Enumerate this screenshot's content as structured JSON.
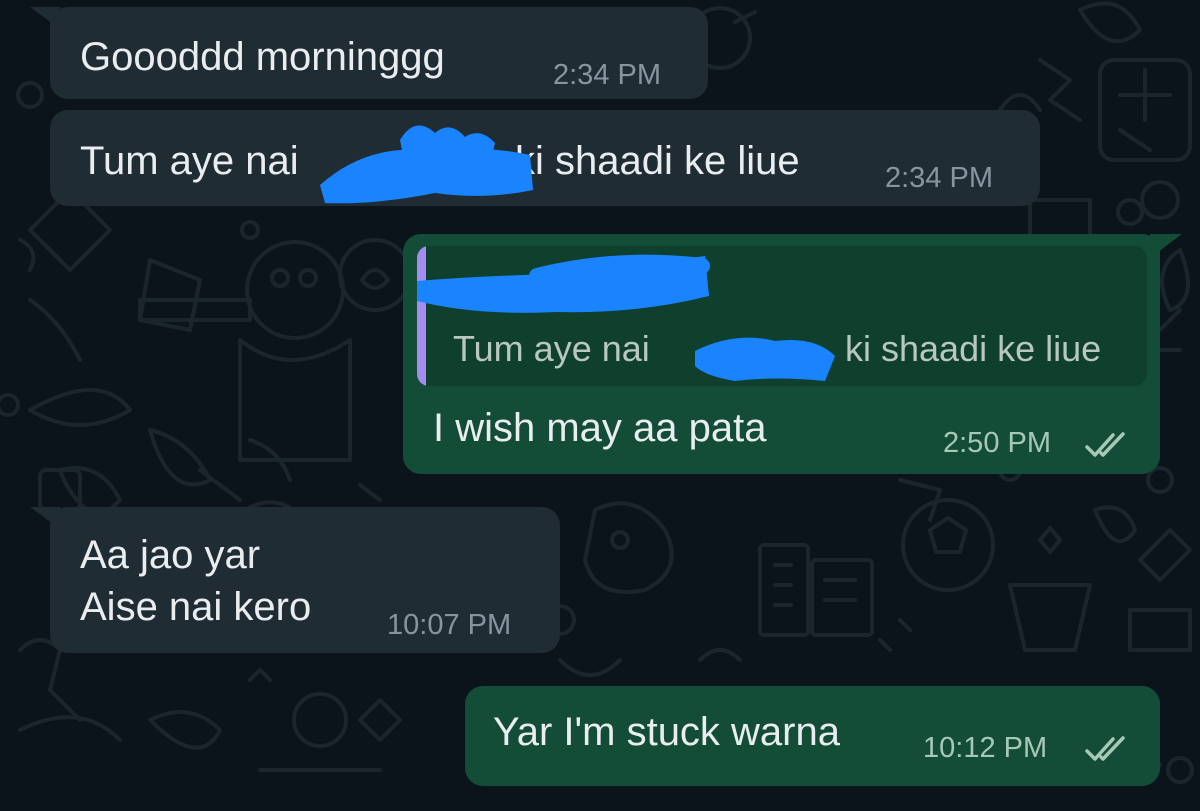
{
  "theme": {
    "background": "#0b141a",
    "incoming_bubble": "#202c33",
    "outgoing_bubble": "#144d37",
    "quote_bar": "#a68cf2",
    "redaction": "#1a84ff",
    "read_ticks": "#a6c9b6"
  },
  "messages": [
    {
      "direction": "incoming",
      "text": "Goooddd morninggg",
      "time": "2:34 PM"
    },
    {
      "direction": "incoming",
      "text_before": "Tum aye nai",
      "text_after": "ki shaadi ke liue",
      "time": "2:34 PM",
      "redacted": true
    },
    {
      "direction": "outgoing",
      "quoted": {
        "text_before": "Tum aye nai",
        "text_after": "ki shaadi ke liue",
        "sender_redacted": true
      },
      "text": "I wish may aa pata",
      "time": "2:50 PM",
      "status_icon": "double-check-icon"
    },
    {
      "direction": "incoming",
      "lines": [
        "Aa jao yar",
        "Aise nai kero"
      ],
      "time": "10:07 PM"
    },
    {
      "direction": "outgoing",
      "text": "Yar I'm stuck warna",
      "time": "10:12 PM",
      "status_icon": "double-check-icon"
    }
  ]
}
